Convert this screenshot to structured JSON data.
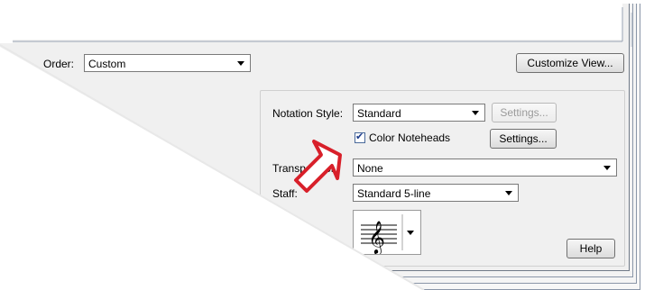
{
  "top_bar": {
    "order_label": "Order:",
    "order_value": "Custom",
    "customize_view_label": "Customize View..."
  },
  "notation": {
    "style_label": "Notation Style:",
    "style_value": "Standard",
    "style_settings_label": "Settings...",
    "color_noteheads_label": "Color Noteheads",
    "color_noteheads_checked": true,
    "color_settings_label": "Settings..."
  },
  "transposition": {
    "label": "Transposition:",
    "value": "None"
  },
  "staff": {
    "label": "Staff:",
    "value": "Standard 5-line"
  },
  "help_label": "Help",
  "colors": {
    "arrow_red": "#d8202a",
    "dialog_bg": "#f0f0f0"
  },
  "icons": {
    "clef": "treble-clef-icon",
    "annotation": "red-arrow-icon"
  }
}
